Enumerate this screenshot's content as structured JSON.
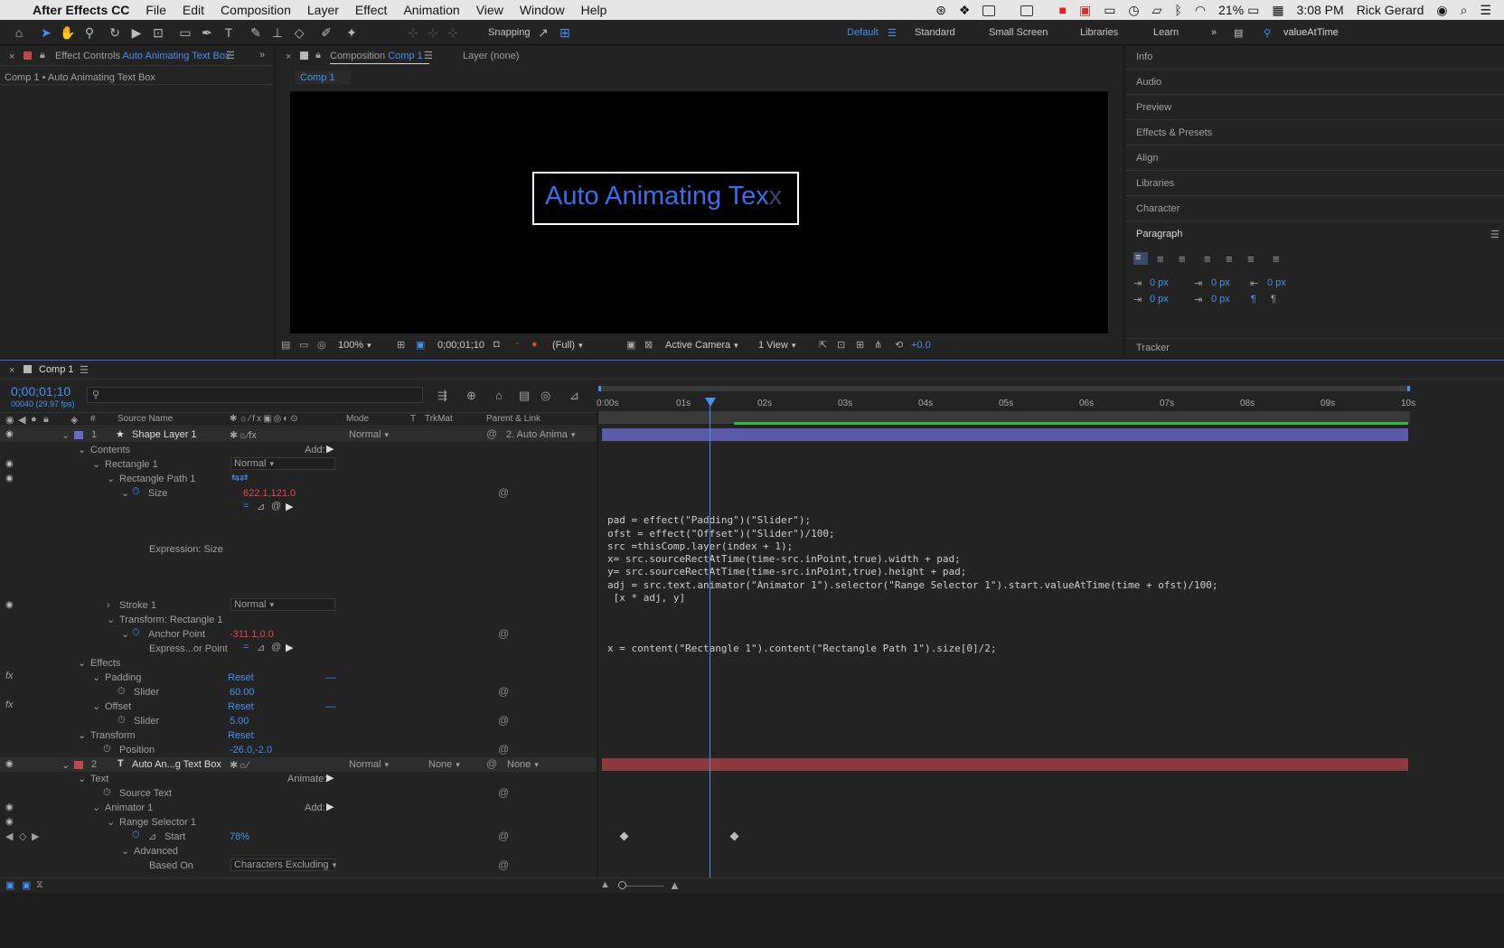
{
  "menubar": {
    "app": "After Effects CC",
    "items": [
      "File",
      "Edit",
      "Composition",
      "Layer",
      "Effect",
      "Animation",
      "View",
      "Window",
      "Help"
    ],
    "battery": "21%",
    "time": "3:08 PM",
    "user": "Rick Gerard"
  },
  "toolbar": {
    "snapping": "Snapping",
    "workspaces": [
      "Default",
      "Standard",
      "Small Screen",
      "Libraries",
      "Learn"
    ],
    "search_value": "valueAtTime"
  },
  "effect_controls": {
    "tab_prefix": "Effect Controls",
    "tab_layer": "Auto Animating Text Box",
    "breadcrumb": "Comp 1 • Auto Animating Text Box"
  },
  "composition": {
    "tab_prefix": "Composition",
    "tab_comp": "Comp 1",
    "layer_tab": "Layer (none)",
    "subtab": "Comp 1",
    "preview_text": "Auto Animating Tex",
    "preview_text_faded": "x",
    "zoom": "100%",
    "timecode": "0;00;01;10",
    "resolution": "(Full)",
    "camera": "Active Camera",
    "views": "1 View",
    "exposure": "+0.0"
  },
  "right_panels": {
    "items": [
      "Info",
      "Audio",
      "Preview",
      "Effects & Presets",
      "Align",
      "Libraries",
      "Character"
    ],
    "paragraph": "Paragraph",
    "px": [
      "0 px",
      "0 px",
      "0 px",
      "0 px",
      "0 px"
    ],
    "tracker": "Tracker"
  },
  "timeline": {
    "tab": "Comp 1",
    "timecode": "0;00;01;10",
    "frames": "00040 (29.97 fps)",
    "headers": {
      "num": "#",
      "source": "Source Name",
      "mode": "Mode",
      "t": "T",
      "trkmat": "TrkMat",
      "parent": "Parent & Link"
    },
    "ruler": [
      "0:00s",
      "01s",
      "02s",
      "03s",
      "04s",
      "05s",
      "06s",
      "07s",
      "08s",
      "09s",
      "10s"
    ],
    "rows": {
      "l1_num": "1",
      "l1_name": "Shape Layer 1",
      "l1_mode": "Normal",
      "l1_parent": "2. Auto Anima",
      "contents": "Contents",
      "add": "Add:",
      "rect1": "Rectangle 1",
      "rect1_mode": "Normal",
      "rect_path": "Rectangle Path 1",
      "size": "Size",
      "size_val": "622.1,121.0",
      "expr_size": "Expression: Size",
      "stroke": "Stroke 1",
      "stroke_mode": "Normal",
      "transform_rect": "Transform: Rectangle 1",
      "anchor": "Anchor Point",
      "anchor_val": "-311.1,0.0",
      "express_or_point": "Express...or Point",
      "effects": "Effects",
      "padding": "Padding",
      "reset": "Reset",
      "slider": "Slider",
      "padding_val": "60.00",
      "offset": "Offset",
      "offset_val": "5.00",
      "transform": "Transform",
      "position": "Position",
      "position_val": "-26.0,-2.0",
      "l2_num": "2",
      "l2_name": "Auto An...g Text Box",
      "l2_mode": "Normal",
      "l2_trkmat": "None",
      "l2_parent": "None",
      "text": "Text",
      "animate": "Animate:",
      "source_text": "Source Text",
      "animator": "Animator 1",
      "range_sel": "Range Selector 1",
      "start": "Start",
      "start_val": "78%",
      "advanced": "Advanced",
      "based_on": "Based On",
      "based_on_val": "Characters Excluding"
    },
    "expr_size": [
      "pad = effect(\"Padding\")(\"Slider\");",
      "ofst = effect(\"Offset\")(\"Slider\")/100;",
      "src =thisComp.layer(index + 1);",
      "x= src.sourceRectAtTime(time-src.inPoint,true).width + pad;",
      "y= src.sourceRectAtTime(time-src.inPoint,true).height + pad;",
      "adj = src.text.animator(\"Animator 1\").selector(\"Range Selector 1\").start.valueAtTime(time + ofst)/100;",
      " [x * adj, y]"
    ],
    "expr_anchor": "x = content(\"Rectangle 1\").content(\"Rectangle Path 1\").size[0]/2;"
  },
  "colors": {
    "accent": "#4a8ff0",
    "label_purple": "#6a6ac8",
    "label_red": "#c0474d",
    "layer_bar_purple": "#5a5aa8",
    "layer_bar_red": "#8c3a3e",
    "workarea_green": "#2bbf3f"
  }
}
